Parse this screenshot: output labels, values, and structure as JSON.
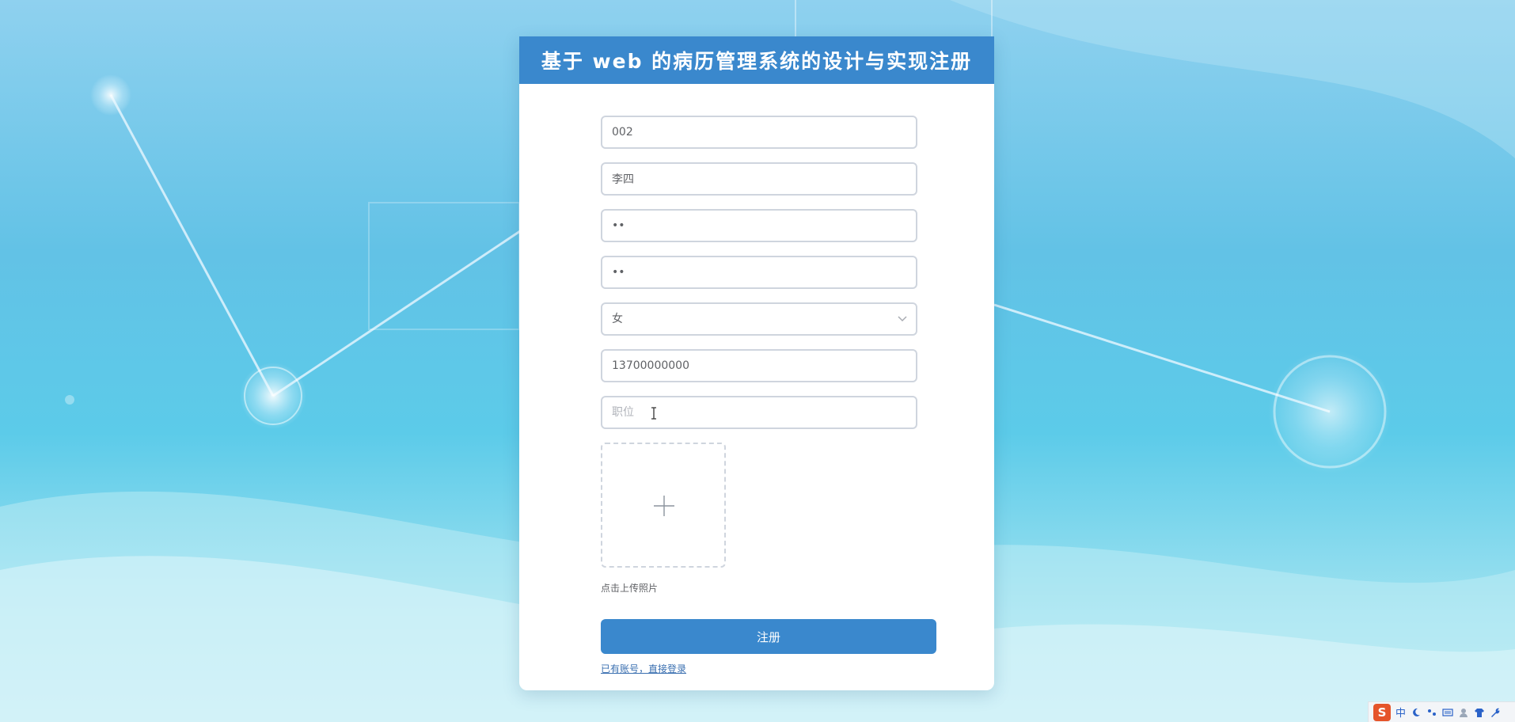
{
  "header": {
    "title": "基于 web 的病历管理系统的设计与实现注册"
  },
  "form": {
    "fields": [
      {
        "name": "account",
        "value": "002",
        "placeholder": "",
        "type": "text"
      },
      {
        "name": "realname",
        "value": "李四",
        "placeholder": "",
        "type": "text"
      },
      {
        "name": "password",
        "value": "11",
        "placeholder": "",
        "type": "password"
      },
      {
        "name": "confirm-password",
        "value": "11",
        "placeholder": "",
        "type": "password"
      }
    ],
    "gender": {
      "selected": "女"
    },
    "phone": {
      "value": "13700000000"
    },
    "position": {
      "value": "",
      "placeholder": "职位"
    },
    "upload_hint": "点击上传照片",
    "submit_label": "注册",
    "login_link": "已有账号，直接登录"
  },
  "tray": {
    "ime_logo": "S",
    "ime_mode": "中",
    "icons": [
      "moon-icon",
      "punctuation-icon",
      "keyboard-icon",
      "user-icon",
      "shirt-icon",
      "wrench-icon"
    ]
  },
  "colors": {
    "accent": "#3a88cd",
    "border": "#cfd5de",
    "background": "#62c2e6"
  }
}
